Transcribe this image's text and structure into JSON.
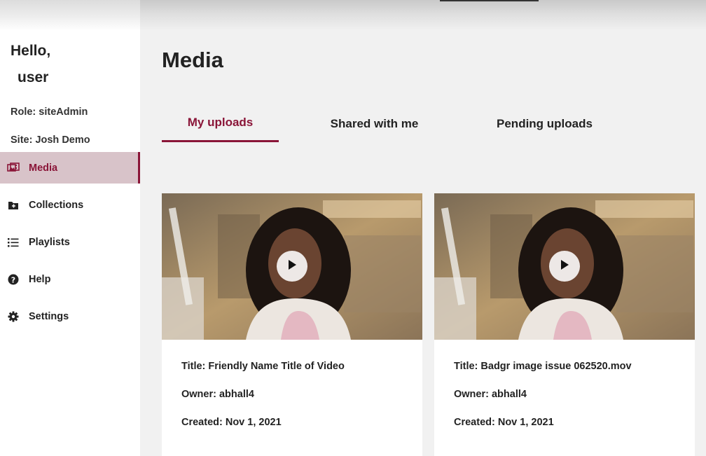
{
  "sidebar": {
    "greeting_line1": "Hello,",
    "greeting_line2": "user",
    "role": "Role: siteAdmin",
    "site": "Site: Josh Demo",
    "items": [
      {
        "label": "Media",
        "icon": "media-icon",
        "active": true
      },
      {
        "label": "Collections",
        "icon": "folder-icon",
        "active": false
      },
      {
        "label": "Playlists",
        "icon": "list-icon",
        "active": false
      },
      {
        "label": "Help",
        "icon": "help-icon",
        "active": false
      },
      {
        "label": "Settings",
        "icon": "gear-icon",
        "active": false
      }
    ]
  },
  "main": {
    "title": "Media",
    "tabs": [
      {
        "label": "My uploads",
        "active": true
      },
      {
        "label": "Shared with me",
        "active": false
      },
      {
        "label": "Pending uploads",
        "active": false
      }
    ],
    "cards": [
      {
        "title": "Title: Friendly Name Title of Video",
        "owner": "Owner: abhall4",
        "created": "Created: Nov 1, 2021"
      },
      {
        "title": "Title: Badgr image issue 062520.mov",
        "owner": "Owner: abhall4",
        "created": "Created: Nov 1, 2021"
      }
    ]
  },
  "colors": {
    "accent": "#8a1538",
    "active_bg": "#d8c3c9",
    "page_bg": "#f1f1f1"
  }
}
